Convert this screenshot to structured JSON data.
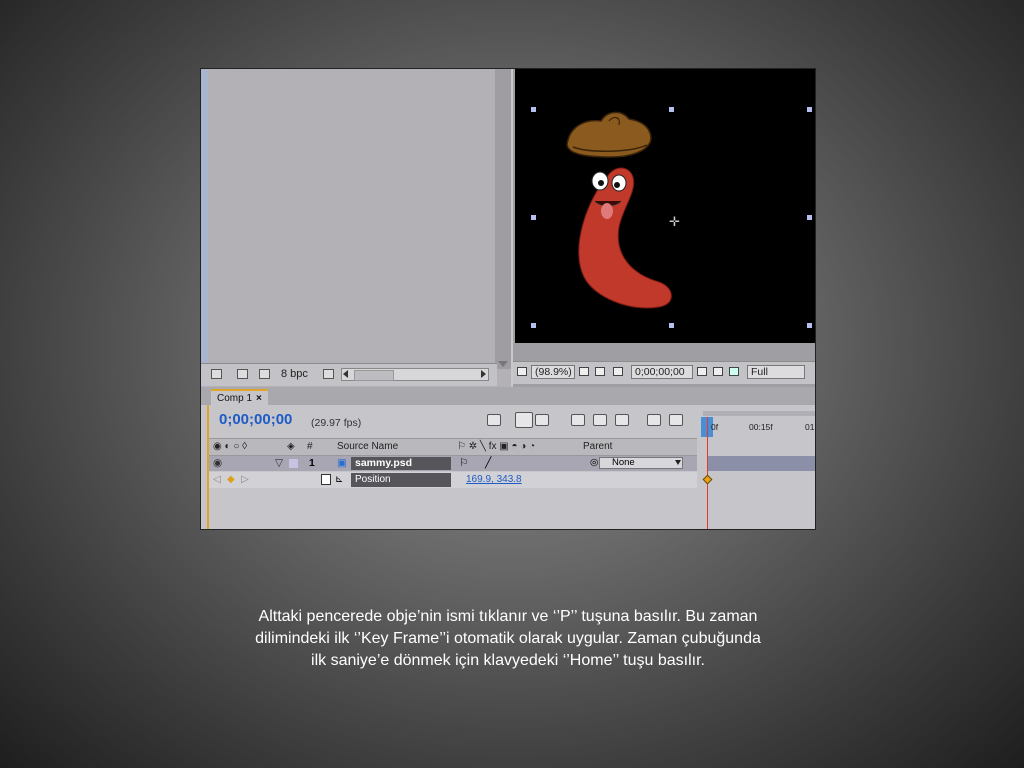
{
  "project_panel": {
    "bpc_label": "8 bpc"
  },
  "viewer_panel": {
    "zoom_value": "(98.9%)",
    "timecode": "0;00;00;00",
    "resolution": "Full"
  },
  "timeline": {
    "tab_label": "Comp 1",
    "tab_close": "×",
    "timecode": "0;00;00;00",
    "fps": "(29.97 fps)",
    "columns": {
      "number": "#",
      "source_name": "Source Name",
      "parent": "Parent"
    },
    "layer": {
      "number": "1",
      "name": "sammy.psd",
      "parent_value": "None"
    },
    "property": {
      "name": "Position",
      "value_x": "169.9",
      "separator": ",",
      "value_y": "343.8"
    },
    "ruler_labels": [
      "0f",
      "00:15f",
      "01"
    ]
  },
  "caption": {
    "line1": "Alttaki pencerede obje’nin ismi tıklanır ve ‘’P’’ tuşuna basılır. Bu zaman",
    "line2": "dilimindeki ilk ‘’Key Frame’’i otomatik olarak uygular. Zaman çubuğunda",
    "line3": "ilk saniye’e dönmek için klavyedeki ‘’Home’’ tuşu basılır."
  },
  "colors": {
    "accent_timecode": "#1d5bc6",
    "tab_highlight": "#e2a42a",
    "playhead": "#e03b2a",
    "keyframe": "#e8a21b",
    "character_body": "#c0392b",
    "hat": "#8a5a1e"
  }
}
